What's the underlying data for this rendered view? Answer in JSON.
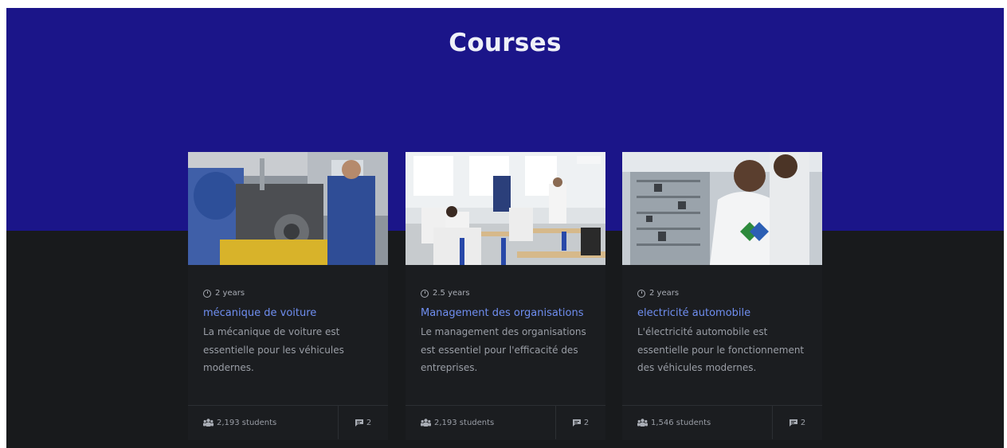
{
  "page": {
    "title": "Courses"
  },
  "colors": {
    "hero": "#1b1589",
    "dark": "#181a1c",
    "card": "#1b1d20",
    "link": "#6f8ef0",
    "text": "#9a9ea6"
  },
  "courses": [
    {
      "duration": "2 years",
      "title": "mécanique de voiture",
      "description": "La mécanique de voiture est essentielle pour les véhicules modernes.",
      "students": "2,193 students",
      "comments": "2",
      "image": "workshop-engine-photo"
    },
    {
      "duration": "2.5 years",
      "title": "Management des organisations",
      "description": "Le management des organisations est essentiel pour l'efficacité des entreprises.",
      "students": "2,193 students",
      "comments": "2",
      "image": "classroom-photo"
    },
    {
      "duration": "2 years",
      "title": "electricité automobile",
      "description": "L'électricité automobile est essentielle pour le fonctionnement des véhicules modernes.",
      "students": "1,546 students",
      "comments": "2",
      "image": "electrical-lab-photo"
    }
  ],
  "icons": {
    "duration": "clock-icon",
    "students": "users-icon",
    "comments": "comment-icon"
  }
}
